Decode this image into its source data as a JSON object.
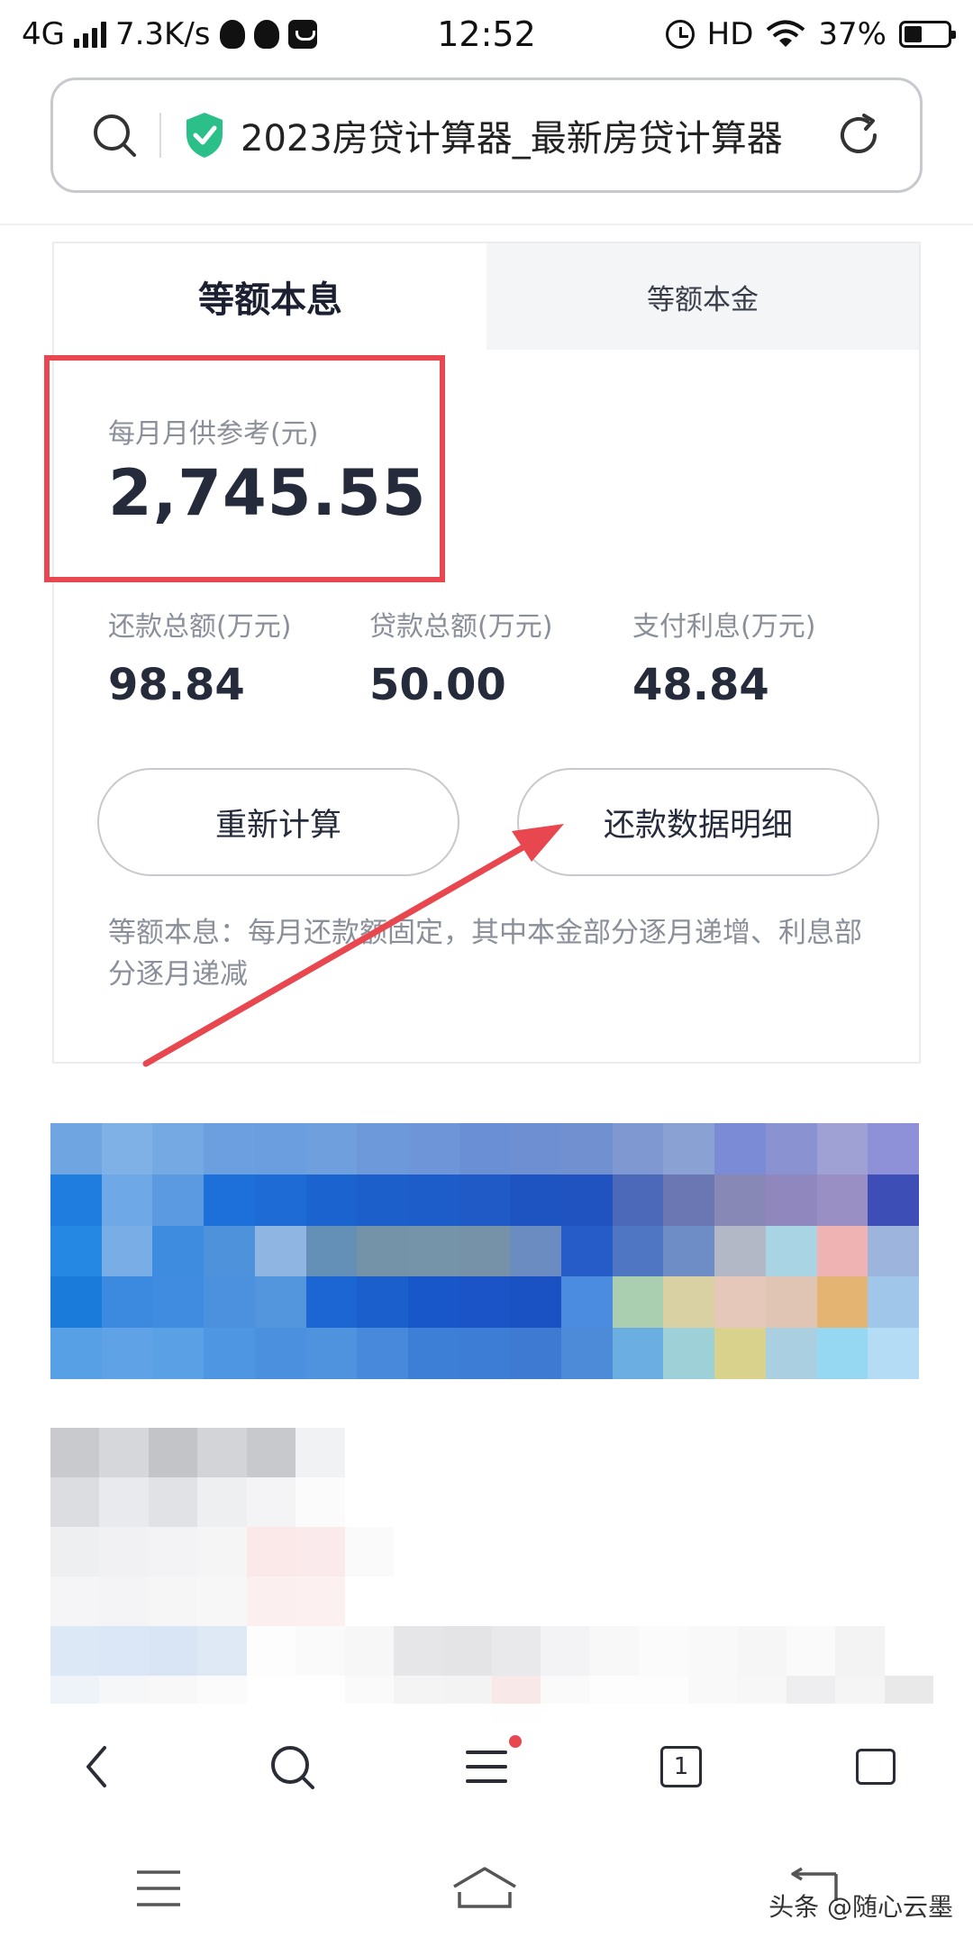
{
  "status_bar": {
    "network": "4G",
    "speed": "7.3K/s",
    "time": "12:52",
    "hd": "HD",
    "battery": "37%",
    "battery_level": 0.37
  },
  "url_bar": {
    "title": "2023房贷计算器_最新房贷计算器",
    "icons": [
      "search-icon",
      "shield-check-icon",
      "refresh-icon"
    ]
  },
  "calculator": {
    "tabs": [
      {
        "label": "等额本息",
        "active": true
      },
      {
        "label": "等额本金",
        "active": false
      }
    ],
    "monthly_payment": {
      "label": "每月月供参考(元)",
      "value": "2,745.55"
    },
    "stats": [
      {
        "label": "还款总额(万元)",
        "value": "98.84"
      },
      {
        "label": "贷款总额(万元)",
        "value": "50.00"
      },
      {
        "label": "支付利息(万元)",
        "value": "48.84"
      }
    ],
    "recalc_button": "重新计算",
    "details_button": "还款数据明细",
    "note": "等额本息：每月还款额固定，其中本金部分逐月递增、利息部分逐月递减"
  },
  "annotations": {
    "highlight_color": "#e8474f"
  },
  "toolbar": {
    "tab_count": "1",
    "icons": [
      "back-icon",
      "search-icon",
      "menu-icon",
      "tabs-icon",
      "square-icon"
    ]
  },
  "system_nav": {
    "icons": [
      "menu-icon",
      "home-icon",
      "back-icon"
    ]
  },
  "watermark": "头条 @随心云墨"
}
